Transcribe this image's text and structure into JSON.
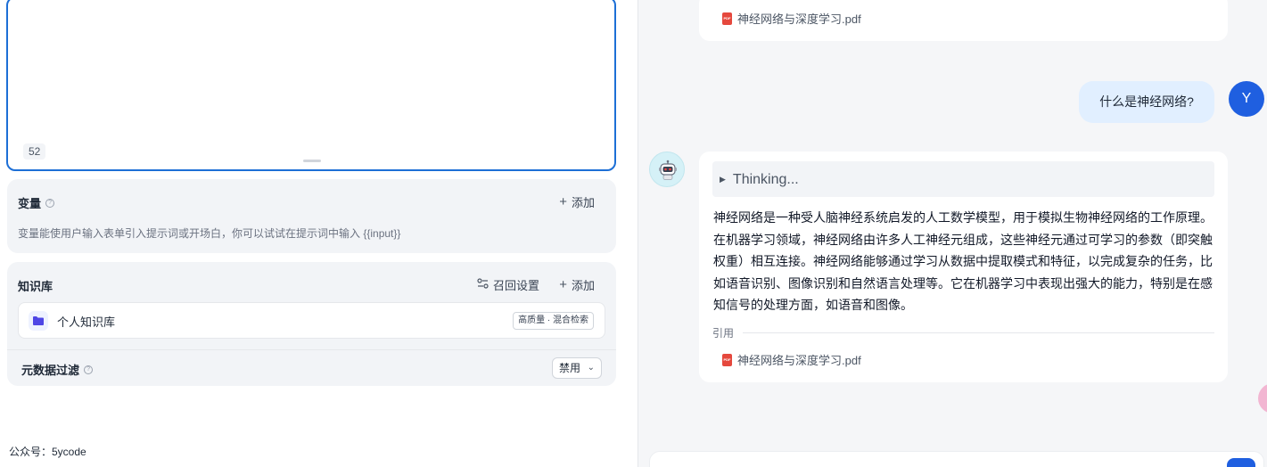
{
  "editor": {
    "char_count": "52"
  },
  "variables": {
    "title": "变量",
    "add_label": "添加",
    "description": "变量能使用户输入表单引入提示词或开场白，你可以试试在提示词中输入 {{input}}"
  },
  "knowledge": {
    "title": "知识库",
    "recall_label": "召回设置",
    "add_label": "添加",
    "items": [
      {
        "name": "个人知识库",
        "badge": "高质量 · 混合检索"
      }
    ]
  },
  "metadata_filter": {
    "title": "元数据过滤",
    "value": "禁用"
  },
  "footer": {
    "note": "公众号：5ycode"
  },
  "chat": {
    "top_file": "神经网络与深度学习.pdf",
    "user_message": "什么是神经网络?",
    "user_avatar_letter": "Y",
    "thinking_label": "Thinking...",
    "answer": "神经网络是一种受人脑神经系统启发的人工数学模型，用于模拟生物神经网络的工作原理。在机器学习领域，神经网络由许多人工神经元组成，这些神经元通过可学习的参数（即突触权重）相互连接。神经网络能够通过学习从数据中提取模式和特征，以完成复杂的任务，比如语音识别、图像识别和自然语言处理等。它在机器学习中表现出强大的能力，特别是在感知信号的处理方面，如语音和图像。",
    "citation_label": "引用",
    "citation_file": "神经网络与深度学习.pdf"
  },
  "colors": {
    "accent": "#1d6fd6",
    "user_avatar": "#1f5fe0",
    "user_bubble": "#e1efff",
    "pdf_red": "#e5483d"
  }
}
